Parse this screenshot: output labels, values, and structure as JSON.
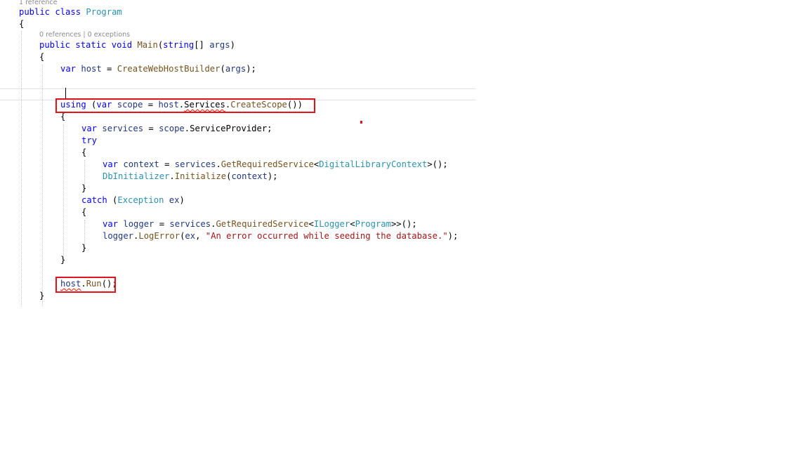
{
  "codelens": {
    "class_refs": "1 reference",
    "main_refs": "0 references",
    "separator": "|",
    "main_exceptions": "0 exceptions"
  },
  "code": {
    "kw_public": "public",
    "kw_class": "class",
    "kw_static": "static",
    "kw_void": "void",
    "kw_string": "string",
    "kw_var": "var",
    "kw_using": "using",
    "kw_try": "try",
    "kw_catch": "catch",
    "class_name": "Program",
    "method_main": "Main",
    "param_args": "args",
    "var_host": "host",
    "var_scope": "scope",
    "var_services": "services",
    "var_context": "context",
    "var_logger": "logger",
    "var_ex": "ex",
    "m_create_web_host_builder": "CreateWebHostBuilder",
    "m_create_scope": "CreateScope",
    "m_get_required_service": "GetRequiredService",
    "m_initialize": "Initialize",
    "m_log_error": "LogError",
    "m_run": "Run",
    "prop_services": "Services",
    "prop_service_provider": "ServiceProvider",
    "t_digital_library_context": "DigitalLibraryContext",
    "t_db_initializer": "DbInitializer",
    "t_exception": "Exception",
    "t_ilogger": "ILogger",
    "str_error": "\"An error occurred while seeding the database.\""
  }
}
